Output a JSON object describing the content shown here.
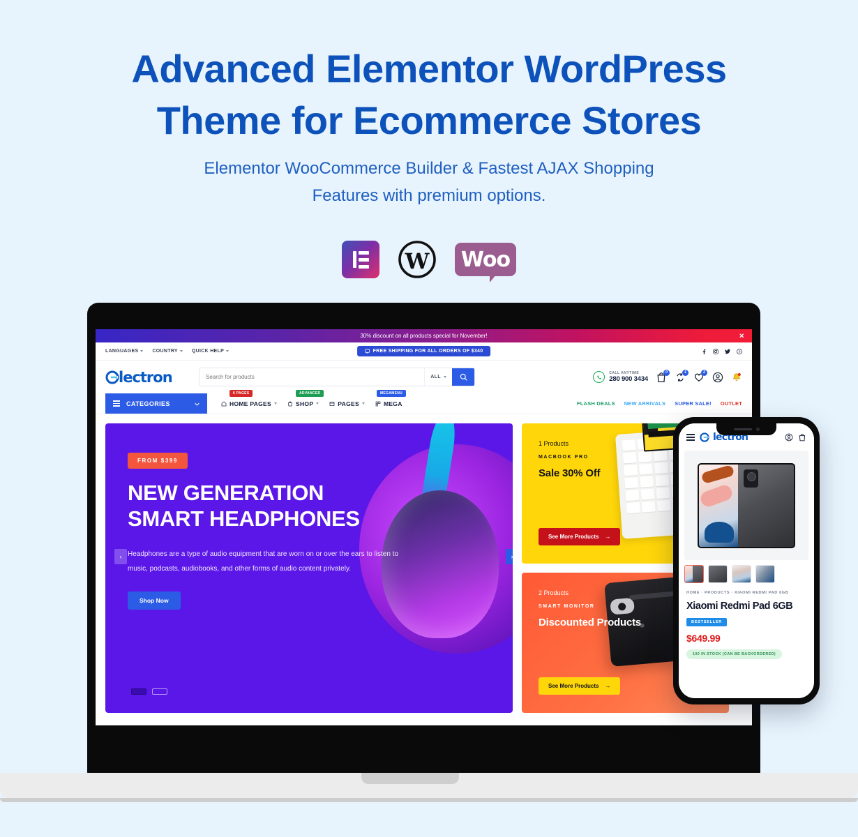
{
  "hero_section": {
    "headline_line1": "Advanced Elementor WordPress",
    "headline_line2": "Theme for Ecommerce Stores",
    "subhead_line1": "Elementor WooCommerce Builder & Fastest AJAX Shopping",
    "subhead_line2": "Features with premium options.",
    "headline_color": "#0d52ba",
    "background_color": "#e8f4fd"
  },
  "tech_logos": [
    {
      "name": "elementor-logo",
      "label": "Elementor"
    },
    {
      "name": "wordpress-logo",
      "label": "WordPress"
    },
    {
      "name": "woocommerce-logo",
      "label": "Woo"
    }
  ],
  "desktop_preview": {
    "announcement": {
      "text": "30% discount on all products special for November!",
      "close_label": "✕"
    },
    "topbar": {
      "links": [
        {
          "label": "LANGUAGES"
        },
        {
          "label": "COUNTRY"
        },
        {
          "label": "QUICK HELP"
        }
      ],
      "shipping_pill": "FREE SHIPPING FOR ALL ORDERS OF $340",
      "social": [
        "facebook-icon",
        "instagram-icon",
        "twitter-icon",
        "pinterest-icon"
      ]
    },
    "header": {
      "brand": "lectron",
      "search_placeholder": "Search for products",
      "search_category": "ALL",
      "call_label": "CALL ANYTIME",
      "call_number": "280 900 3434",
      "icons": [
        {
          "name": "cart-icon",
          "count": "0"
        },
        {
          "name": "compare-icon",
          "count": "1"
        },
        {
          "name": "wishlist-icon",
          "count": "2"
        },
        {
          "name": "account-icon",
          "count": ""
        },
        {
          "name": "notification-icon",
          "count": ""
        }
      ]
    },
    "nav": {
      "categories_label": "CATEGORIES",
      "items": [
        {
          "label": "HOME PAGES",
          "badge": "6 PAGES",
          "badge_color": "#d62828",
          "caret": true
        },
        {
          "label": "SHOP",
          "badge": "ADVANCED",
          "badge_color": "#1f9d55",
          "caret": true
        },
        {
          "label": "PAGES",
          "badge": "",
          "badge_color": "",
          "caret": true
        },
        {
          "label": "MEGA",
          "badge": "MEGAMENU",
          "badge_color": "#2c5ce6",
          "caret": false
        }
      ],
      "promos": [
        {
          "label": "FLASH DEALS",
          "color": "#22a06b"
        },
        {
          "label": "NEW ARRIVALS",
          "color": "#3fa9f5"
        },
        {
          "label": "SUPER SALE!",
          "color": "#2c5ce6"
        },
        {
          "label": "OUTLET",
          "color": "#e0342b"
        }
      ]
    },
    "hero_banner": {
      "price_pill": "FROM $399",
      "title_line1": "NEW GENERATION",
      "title_line2": "SMART HEADPHONES",
      "description": "Headphones are a type of audio equipment that are worn on or over the ears to listen to music, podcasts, audiobooks, and other forms of audio content privately.",
      "cta_label": "Shop Now",
      "prev_label": "‹",
      "next_label": "›",
      "background_color": "#5b17e8"
    },
    "promo_cards": [
      {
        "count": "1 Products",
        "kicker": "MACBOOK PRO",
        "title": "Sale 30% Off",
        "cta": "See More Products",
        "arrow": "→",
        "background_color": "#ffd60a"
      },
      {
        "count": "2 Products",
        "kicker": "SMART MONITOR",
        "title": "Discounted Products",
        "cta": "See More Products",
        "arrow": "→",
        "background_color": "#ff5a35"
      }
    ]
  },
  "mobile_preview": {
    "brand": "lectron",
    "breadcrumb": "HOME · PRODUCTS · XIAOMI REDMI PAD 6GB",
    "product_title": "Xiaomi Redmi Pad 6GB",
    "badge": "BESTSELLER",
    "price": "$649.99",
    "stock": "100 IN STOCK (CAN BE BACKORDERED)"
  }
}
